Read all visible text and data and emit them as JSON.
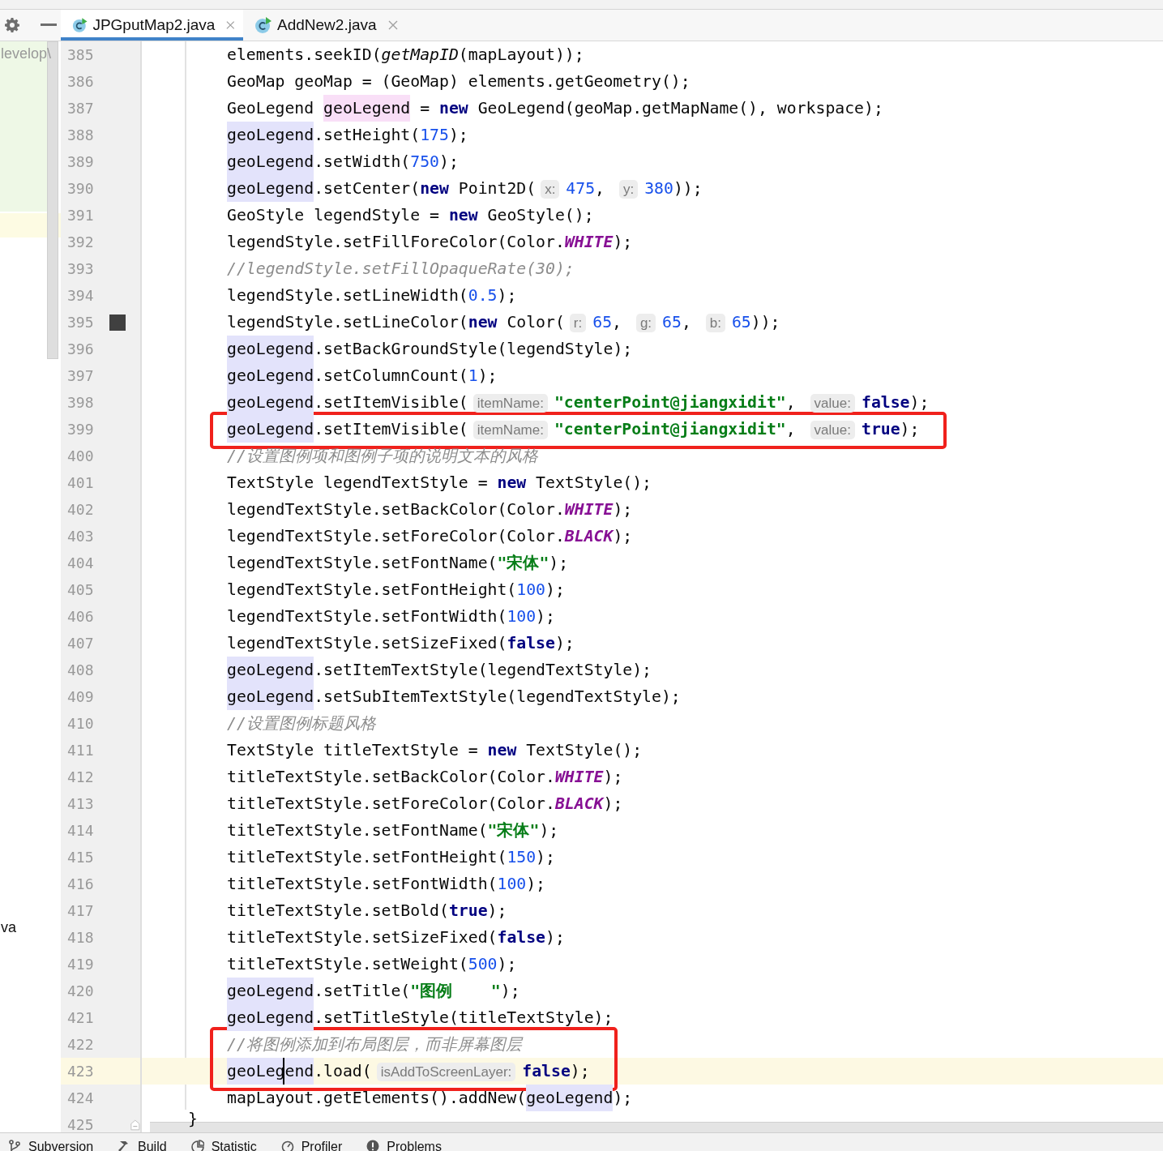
{
  "tabs": [
    {
      "label": "JPGputMap2.java",
      "selected": true
    },
    {
      "label": "AddNew2.java",
      "selected": false
    }
  ],
  "project_panel": {
    "items": [
      {
        "text": "levelop\\",
        "dimmed": true
      },
      {
        "text": "va",
        "dimmed": false
      }
    ]
  },
  "editor": {
    "blocks": [
      {
        "boxed": false,
        "lines": [
          {
            "number": "385",
            "current": false,
            "kind": "code",
            "tokens": [
              {
                "kind": "plain",
                "text": "elements.seekID("
              },
              {
                "kind": "italic",
                "text": "getMapID"
              },
              {
                "kind": "plain",
                "text": "(mapLayout));"
              }
            ]
          },
          {
            "number": "386",
            "current": false,
            "kind": "code",
            "tokens": [
              {
                "kind": "plain",
                "text": "GeoMap geoMap = (GeoMap) elements.getGeometry();"
              }
            ]
          },
          {
            "number": "387",
            "current": false,
            "kind": "code",
            "tokens": [
              {
                "kind": "plain",
                "text": "GeoLegend "
              },
              {
                "kind": "def",
                "text": "geoLegend"
              },
              {
                "kind": "plain",
                "text": " = "
              },
              {
                "kind": "kw",
                "text": "new"
              },
              {
                "kind": "plain",
                "text": " GeoLegend(geoMap.getMapName(), workspace);"
              }
            ]
          },
          {
            "number": "388",
            "current": false,
            "kind": "code",
            "tokens": [
              {
                "kind": "use",
                "text": "geoLegend"
              },
              {
                "kind": "plain",
                "text": ".setHeight("
              },
              {
                "kind": "num",
                "text": "175"
              },
              {
                "kind": "plain",
                "text": ");"
              }
            ]
          },
          {
            "number": "389",
            "current": false,
            "kind": "code",
            "tokens": [
              {
                "kind": "use",
                "text": "geoLegend"
              },
              {
                "kind": "plain",
                "text": ".setWidth("
              },
              {
                "kind": "num",
                "text": "750"
              },
              {
                "kind": "plain",
                "text": ");"
              }
            ]
          },
          {
            "number": "390",
            "current": false,
            "kind": "code",
            "tokens": [
              {
                "kind": "use",
                "text": "geoLegend"
              },
              {
                "kind": "plain",
                "text": ".setCenter("
              },
              {
                "kind": "kw",
                "text": "new"
              },
              {
                "kind": "plain",
                "text": " Point2D("
              },
              {
                "kind": "hint",
                "text": "x:"
              },
              {
                "kind": "num",
                "text": "475"
              },
              {
                "kind": "plain",
                "text": ", "
              },
              {
                "kind": "hint",
                "text": "y:"
              },
              {
                "kind": "num",
                "text": "380"
              },
              {
                "kind": "plain",
                "text": "));"
              }
            ]
          },
          {
            "number": "391",
            "current": false,
            "kind": "code",
            "tokens": [
              {
                "kind": "plain",
                "text": "GeoStyle legendStyle = "
              },
              {
                "kind": "kw",
                "text": "new"
              },
              {
                "kind": "plain",
                "text": " GeoStyle();"
              }
            ]
          },
          {
            "number": "392",
            "current": false,
            "kind": "code",
            "tokens": [
              {
                "kind": "plain",
                "text": "legendStyle.setFillForeColor(Color."
              },
              {
                "kind": "const",
                "text": "WHITE"
              },
              {
                "kind": "plain",
                "text": ");"
              }
            ]
          },
          {
            "number": "393",
            "current": false,
            "kind": "code",
            "tokens": [
              {
                "kind": "comment",
                "text": "//legendStyle.setFillOpaqueRate(30);"
              }
            ]
          },
          {
            "number": "394",
            "current": false,
            "kind": "code",
            "tokens": [
              {
                "kind": "plain",
                "text": "legendStyle.setLineWidth("
              },
              {
                "kind": "num",
                "text": "0.5"
              },
              {
                "kind": "plain",
                "text": ");"
              }
            ]
          },
          {
            "number": "395",
            "current": false,
            "kind": "code",
            "color_swatch": true,
            "tokens": [
              {
                "kind": "plain",
                "text": "legendStyle.setLineColor("
              },
              {
                "kind": "kw",
                "text": "new"
              },
              {
                "kind": "plain",
                "text": " Color("
              },
              {
                "kind": "hint",
                "text": "r:"
              },
              {
                "kind": "num",
                "text": "65"
              },
              {
                "kind": "plain",
                "text": ", "
              },
              {
                "kind": "hint",
                "text": "g:"
              },
              {
                "kind": "num",
                "text": "65"
              },
              {
                "kind": "plain",
                "text": ", "
              },
              {
                "kind": "hint",
                "text": "b:"
              },
              {
                "kind": "num",
                "text": "65"
              },
              {
                "kind": "plain",
                "text": "));"
              }
            ]
          },
          {
            "number": "396",
            "current": false,
            "kind": "code",
            "tokens": [
              {
                "kind": "use",
                "text": "geoLegend"
              },
              {
                "kind": "plain",
                "text": ".setBackGroundStyle(legendStyle);"
              }
            ]
          },
          {
            "number": "397",
            "current": false,
            "kind": "code",
            "tokens": [
              {
                "kind": "use",
                "text": "geoLegend"
              },
              {
                "kind": "plain",
                "text": ".setColumnCount("
              },
              {
                "kind": "num",
                "text": "1"
              },
              {
                "kind": "plain",
                "text": ");"
              }
            ]
          },
          {
            "number": "398",
            "current": false,
            "kind": "code",
            "tokens": [
              {
                "kind": "use",
                "text": "geoLegend"
              },
              {
                "kind": "plain",
                "text": ".setItemVisible("
              },
              {
                "kind": "hint",
                "text": "itemName:"
              },
              {
                "kind": "str",
                "text": "\"centerPoint@jiangxidit\""
              },
              {
                "kind": "plain",
                "text": ", "
              },
              {
                "kind": "hint",
                "text": "value:"
              },
              {
                "kind": "kw",
                "text": "false"
              },
              {
                "kind": "plain",
                "text": ");"
              }
            ]
          }
        ]
      },
      {
        "boxed": true,
        "lines": [
          {
            "number": "399",
            "current": false,
            "kind": "code",
            "tokens": [
              {
                "kind": "use",
                "text": "geoLegend"
              },
              {
                "kind": "plain",
                "text": ".setItemVisible("
              },
              {
                "kind": "hint",
                "text": "itemName:"
              },
              {
                "kind": "str",
                "text": "\"centerPoint@jiangxidit\""
              },
              {
                "kind": "plain",
                "text": ", "
              },
              {
                "kind": "hint",
                "text": "value:"
              },
              {
                "kind": "kw",
                "text": "true"
              },
              {
                "kind": "plain",
                "text": ");"
              }
            ]
          }
        ]
      },
      {
        "boxed": false,
        "lines": [
          {
            "number": "400",
            "current": false,
            "kind": "code",
            "tokens": [
              {
                "kind": "comment",
                "text": "//设置图例项和图例子项的说明文本的风格"
              }
            ]
          },
          {
            "number": "401",
            "current": false,
            "kind": "code",
            "tokens": [
              {
                "kind": "plain",
                "text": "TextStyle legendTextStyle = "
              },
              {
                "kind": "kw",
                "text": "new"
              },
              {
                "kind": "plain",
                "text": " TextStyle();"
              }
            ]
          },
          {
            "number": "402",
            "current": false,
            "kind": "code",
            "tokens": [
              {
                "kind": "plain",
                "text": "legendTextStyle.setBackColor(Color."
              },
              {
                "kind": "const",
                "text": "WHITE"
              },
              {
                "kind": "plain",
                "text": ");"
              }
            ]
          },
          {
            "number": "403",
            "current": false,
            "kind": "code",
            "tokens": [
              {
                "kind": "plain",
                "text": "legendTextStyle.setForeColor(Color."
              },
              {
                "kind": "const",
                "text": "BLACK"
              },
              {
                "kind": "plain",
                "text": ");"
              }
            ]
          },
          {
            "number": "404",
            "current": false,
            "kind": "code",
            "tokens": [
              {
                "kind": "plain",
                "text": "legendTextStyle.setFontName("
              },
              {
                "kind": "str",
                "text": "\"宋体\""
              },
              {
                "kind": "plain",
                "text": ");"
              }
            ]
          },
          {
            "number": "405",
            "current": false,
            "kind": "code",
            "tokens": [
              {
                "kind": "plain",
                "text": "legendTextStyle.setFontHeight("
              },
              {
                "kind": "num",
                "text": "100"
              },
              {
                "kind": "plain",
                "text": ");"
              }
            ]
          },
          {
            "number": "406",
            "current": false,
            "kind": "code",
            "tokens": [
              {
                "kind": "plain",
                "text": "legendTextStyle.setFontWidth("
              },
              {
                "kind": "num",
                "text": "100"
              },
              {
                "kind": "plain",
                "text": ");"
              }
            ]
          },
          {
            "number": "407",
            "current": false,
            "kind": "code",
            "tokens": [
              {
                "kind": "plain",
                "text": "legendTextStyle.setSizeFixed("
              },
              {
                "kind": "kw",
                "text": "false"
              },
              {
                "kind": "plain",
                "text": ");"
              }
            ]
          },
          {
            "number": "408",
            "current": false,
            "kind": "code",
            "tokens": [
              {
                "kind": "use",
                "text": "geoLegend"
              },
              {
                "kind": "plain",
                "text": ".setItemTextStyle(legendTextStyle);"
              }
            ]
          },
          {
            "number": "409",
            "current": false,
            "kind": "code",
            "tokens": [
              {
                "kind": "use",
                "text": "geoLegend"
              },
              {
                "kind": "plain",
                "text": ".setSubItemTextStyle(legendTextStyle);"
              }
            ]
          },
          {
            "number": "410",
            "current": false,
            "kind": "code",
            "tokens": [
              {
                "kind": "comment",
                "text": "//设置图例标题风格"
              }
            ]
          },
          {
            "number": "411",
            "current": false,
            "kind": "code",
            "tokens": [
              {
                "kind": "plain",
                "text": "TextStyle titleTextStyle = "
              },
              {
                "kind": "kw",
                "text": "new"
              },
              {
                "kind": "plain",
                "text": " TextStyle();"
              }
            ]
          },
          {
            "number": "412",
            "current": false,
            "kind": "code",
            "tokens": [
              {
                "kind": "plain",
                "text": "titleTextStyle.setBackColor(Color."
              },
              {
                "kind": "const",
                "text": "WHITE"
              },
              {
                "kind": "plain",
                "text": ");"
              }
            ]
          },
          {
            "number": "413",
            "current": false,
            "kind": "code",
            "tokens": [
              {
                "kind": "plain",
                "text": "titleTextStyle.setForeColor(Color."
              },
              {
                "kind": "const",
                "text": "BLACK"
              },
              {
                "kind": "plain",
                "text": ");"
              }
            ]
          },
          {
            "number": "414",
            "current": false,
            "kind": "code",
            "tokens": [
              {
                "kind": "plain",
                "text": "titleTextStyle.setFontName("
              },
              {
                "kind": "str",
                "text": "\"宋体\""
              },
              {
                "kind": "plain",
                "text": ");"
              }
            ]
          },
          {
            "number": "415",
            "current": false,
            "kind": "code",
            "tokens": [
              {
                "kind": "plain",
                "text": "titleTextStyle.setFontHeight("
              },
              {
                "kind": "num",
                "text": "150"
              },
              {
                "kind": "plain",
                "text": ");"
              }
            ]
          },
          {
            "number": "416",
            "current": false,
            "kind": "code",
            "tokens": [
              {
                "kind": "plain",
                "text": "titleTextStyle.setFontWidth("
              },
              {
                "kind": "num",
                "text": "100"
              },
              {
                "kind": "plain",
                "text": ");"
              }
            ]
          },
          {
            "number": "417",
            "current": false,
            "kind": "code",
            "tokens": [
              {
                "kind": "plain",
                "text": "titleTextStyle.setBold("
              },
              {
                "kind": "kw",
                "text": "true"
              },
              {
                "kind": "plain",
                "text": ");"
              }
            ]
          },
          {
            "number": "418",
            "current": false,
            "kind": "code",
            "tokens": [
              {
                "kind": "plain",
                "text": "titleTextStyle.setSizeFixed("
              },
              {
                "kind": "kw",
                "text": "false"
              },
              {
                "kind": "plain",
                "text": ");"
              }
            ]
          },
          {
            "number": "419",
            "current": false,
            "kind": "code",
            "tokens": [
              {
                "kind": "plain",
                "text": "titleTextStyle.setWeight("
              },
              {
                "kind": "num",
                "text": "500"
              },
              {
                "kind": "plain",
                "text": ");"
              }
            ]
          },
          {
            "number": "420",
            "current": false,
            "kind": "code",
            "tokens": [
              {
                "kind": "use",
                "text": "geoLegend"
              },
              {
                "kind": "plain",
                "text": ".setTitle("
              },
              {
                "kind": "str",
                "text": "\"图例    \""
              },
              {
                "kind": "plain",
                "text": ");"
              }
            ]
          },
          {
            "number": "421",
            "current": false,
            "kind": "code",
            "tokens": [
              {
                "kind": "use",
                "text": "geoLegend"
              },
              {
                "kind": "plain",
                "text": ".setTitleStyle(titleTextStyle);"
              }
            ]
          }
        ]
      },
      {
        "boxed": true,
        "lines": [
          {
            "number": "422",
            "current": false,
            "kind": "code",
            "tokens": [
              {
                "kind": "comment",
                "text": "//将图例添加到布局图层，而非屏幕图层"
              }
            ]
          },
          {
            "number": "423",
            "current": true,
            "kind": "code",
            "tokens": [
              {
                "kind": "use",
                "text": "geoLeg"
              },
              {
                "kind": "use",
                "text": "end",
                "caret": true
              },
              {
                "kind": "plain",
                "text": ".load("
              },
              {
                "kind": "hint",
                "text": "isAddToScreenLayer:"
              },
              {
                "kind": "kw",
                "text": "false"
              },
              {
                "kind": "plain",
                "text": ");"
              }
            ]
          }
        ]
      },
      {
        "boxed": false,
        "lines": [
          {
            "number": "424",
            "current": false,
            "kind": "code",
            "tokens": [
              {
                "kind": "plain",
                "text": "mapLayout.getElements().addNew("
              },
              {
                "kind": "use",
                "text": "geoLegend"
              },
              {
                "kind": "plain",
                "text": ");"
              }
            ]
          },
          {
            "number": "425",
            "current": false,
            "kind": "block_end",
            "tokens": [
              {
                "kind": "plain",
                "text": "}"
              }
            ]
          }
        ]
      }
    ]
  },
  "tool_windows": [
    {
      "label": "Subversion",
      "kind": "branch"
    },
    {
      "label": "Build",
      "kind": "hammer"
    },
    {
      "label": "Statistic",
      "kind": "pie"
    },
    {
      "label": "Profiler",
      "kind": "gauge"
    },
    {
      "label": "Problems",
      "kind": "alert"
    }
  ]
}
